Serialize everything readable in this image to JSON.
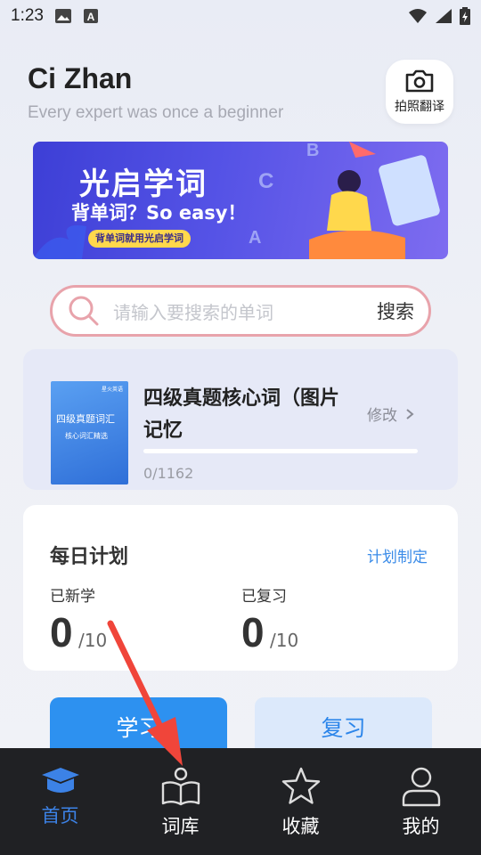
{
  "status_bar": {
    "time": "1:23"
  },
  "header": {
    "title": "Ci Zhan",
    "subtitle": "Every expert was once a beginner",
    "camera_label": "拍照翻译"
  },
  "banner": {
    "title": "光启学词",
    "subtitle": "背单词？So easy！",
    "tag": "背单词就用光启学词"
  },
  "search": {
    "placeholder": "请输入要搜索的单词",
    "button_label": "搜索"
  },
  "book": {
    "cover_top": "星火英语",
    "cover_title": "四级真题词汇",
    "cover_subtitle": "核心词汇精选",
    "name": "四级真题核心词（图片记忆",
    "edit_label": "修改",
    "progress": "0/1162",
    "progress_fraction": 0
  },
  "plan": {
    "title": "每日计划",
    "link": "计划制定",
    "new_label": "已新学",
    "new_value": "0",
    "new_total": "/10",
    "review_label": "已复习",
    "review_value": "0",
    "review_total": "/10"
  },
  "actions": {
    "learn": "学习",
    "review": "复习"
  },
  "tabbar": {
    "items": [
      {
        "label": "首页",
        "icon": "graduation-cap-icon",
        "active": true
      },
      {
        "label": "词库",
        "icon": "reader-book-icon",
        "active": false
      },
      {
        "label": "收藏",
        "icon": "star-icon",
        "active": false
      },
      {
        "label": "我的",
        "icon": "user-icon",
        "active": false
      }
    ]
  },
  "colors": {
    "accent": "#2d91f0",
    "active_tab": "#3c82e6",
    "tabbar_bg": "#202124",
    "annotation_arrow": "#f0453a"
  }
}
